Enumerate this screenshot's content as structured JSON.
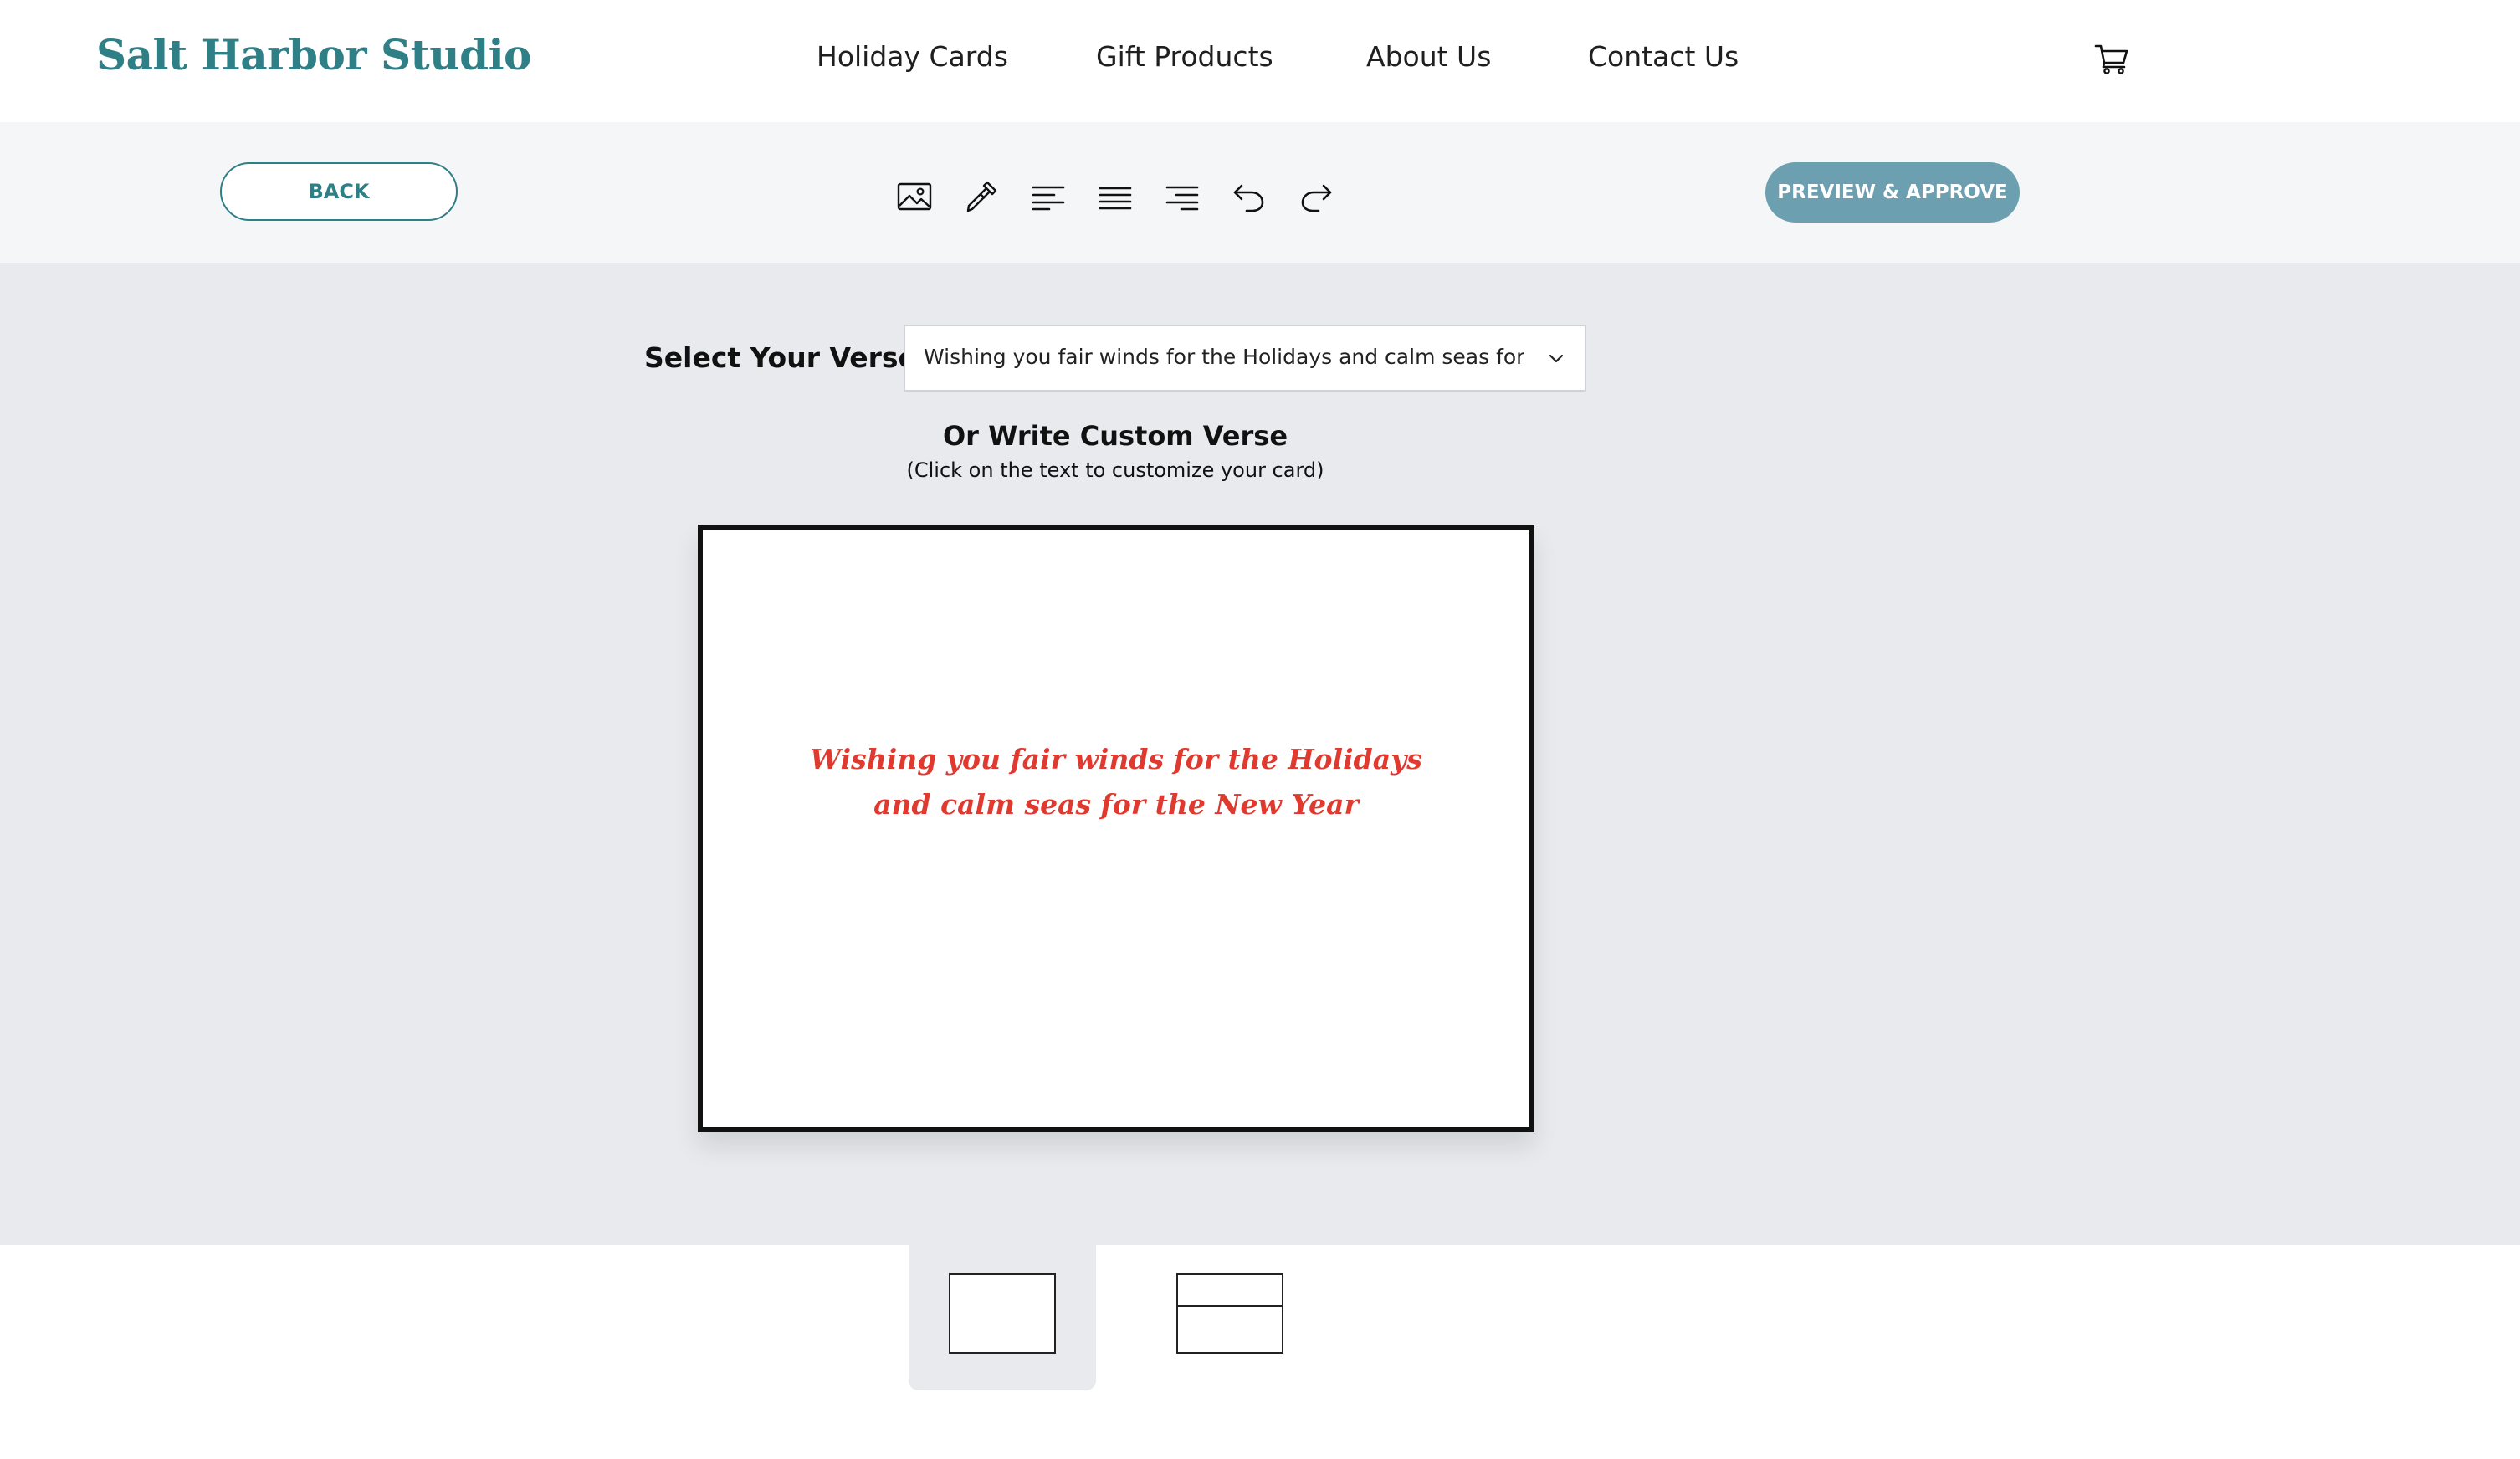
{
  "header": {
    "logo": "Salt Harbor Studio",
    "nav": [
      "Holiday Cards",
      "Gift Products",
      "About Us",
      "Contact Us"
    ],
    "cart_icon": "shopping-cart-icon"
  },
  "toolbar": {
    "back_label": "BACK",
    "tools": [
      "image-icon",
      "eyedropper-icon",
      "align-left-icon",
      "align-center-icon",
      "align-right-icon",
      "undo-icon",
      "redo-icon"
    ],
    "preview_label": "PREVIEW & APPROVE"
  },
  "editor": {
    "verse_label": "Select Your Verse",
    "verse_selected": "Wishing you fair winds for the Holidays and calm seas for the New Year",
    "custom_title": "Or Write Custom Verse",
    "custom_subtitle": "(Click on the text to customize your card)",
    "card_lines": [
      "Wishing you fair winds for the Holidays",
      "and calm seas for the New Year"
    ]
  },
  "thumbnails": [
    "card-front",
    "card-inside"
  ],
  "colors": {
    "brand": "#2f7f86",
    "preview_button": "#6c9faf",
    "verse_text": "#e0392f",
    "editor_bg": "#e8eaee",
    "toolbar_bg": "#f4f6f8"
  }
}
